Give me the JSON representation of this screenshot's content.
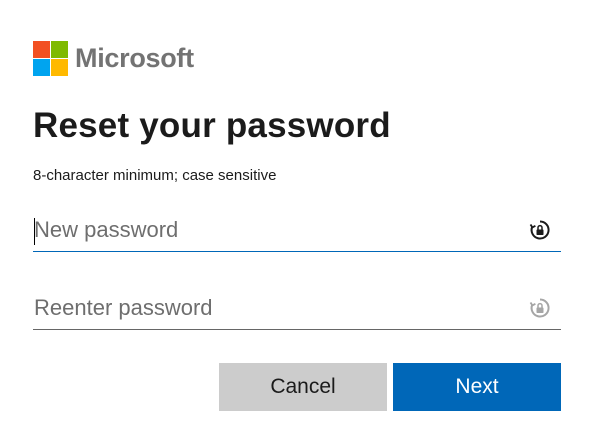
{
  "brand": {
    "name": "Microsoft",
    "logo_colors": [
      "#f25022",
      "#7fba00",
      "#00a4ef",
      "#ffb900"
    ]
  },
  "page": {
    "title": "Reset your password",
    "hint": "8-character minimum; case sensitive"
  },
  "fields": {
    "new_password": {
      "value": "",
      "placeholder": "New password",
      "icon": "password-reveal-icon"
    },
    "reenter_password": {
      "value": "",
      "placeholder": "Reenter password",
      "icon": "password-reveal-icon"
    }
  },
  "actions": {
    "cancel_label": "Cancel",
    "next_label": "Next"
  },
  "colors": {
    "accent": "#0067b8",
    "secondary_button": "#cccccc"
  }
}
